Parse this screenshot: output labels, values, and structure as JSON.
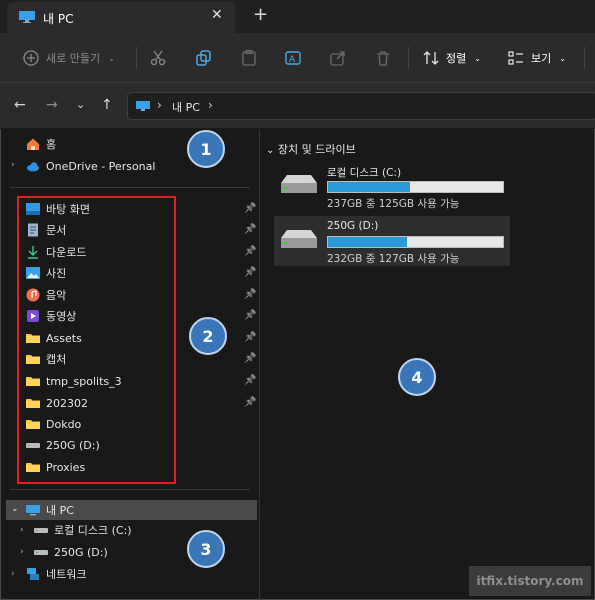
{
  "tab": {
    "title": "내 PC",
    "close": "✕",
    "add": "+"
  },
  "toolbar": {
    "new_label": "새로 만들기",
    "sort_label": "정렬",
    "view_label": "보기"
  },
  "address": {
    "separator": "›",
    "location": "내 PC"
  },
  "sidebar": {
    "home": "홈",
    "onedrive": "OneDrive - Personal",
    "quick_access": [
      {
        "label": "바탕 화면",
        "icon": "desktop-icon"
      },
      {
        "label": "문서",
        "icon": "document-icon"
      },
      {
        "label": "다운로드",
        "icon": "download-icon"
      },
      {
        "label": "사진",
        "icon": "pictures-icon"
      },
      {
        "label": "음악",
        "icon": "music-icon"
      },
      {
        "label": "동영상",
        "icon": "video-icon"
      },
      {
        "label": "Assets",
        "icon": "folder-icon"
      },
      {
        "label": "캡처",
        "icon": "folder-icon"
      },
      {
        "label": "tmp_spolits_3",
        "icon": "folder-icon"
      },
      {
        "label": "202302",
        "icon": "folder-icon"
      },
      {
        "label": "Dokdo",
        "icon": "folder-icon"
      },
      {
        "label": "250G (D:)",
        "icon": "drive-icon"
      },
      {
        "label": "Proxies",
        "icon": "folder-icon"
      }
    ],
    "this_pc": "내 PC",
    "local_disk": "로컬 디스크 (C:)",
    "drive_d": "250G (D:)",
    "network": "네트워크"
  },
  "content": {
    "group_header": "장치 및 드라이브",
    "drives": [
      {
        "name": "로컬 디스크 (C:)",
        "info": "237GB 중 125GB 사용 가능",
        "used_fraction": 0.47
      },
      {
        "name": "250G (D:)",
        "info": "232GB 중 127GB 사용 가능",
        "used_fraction": 0.45
      }
    ]
  },
  "badges": [
    "1",
    "2",
    "3",
    "4"
  ],
  "watermark": "itfix.tistory.com",
  "colors": {
    "accent": "#2a9ad6",
    "highlight_box": "#e02020",
    "badge": "#3a75b8"
  }
}
